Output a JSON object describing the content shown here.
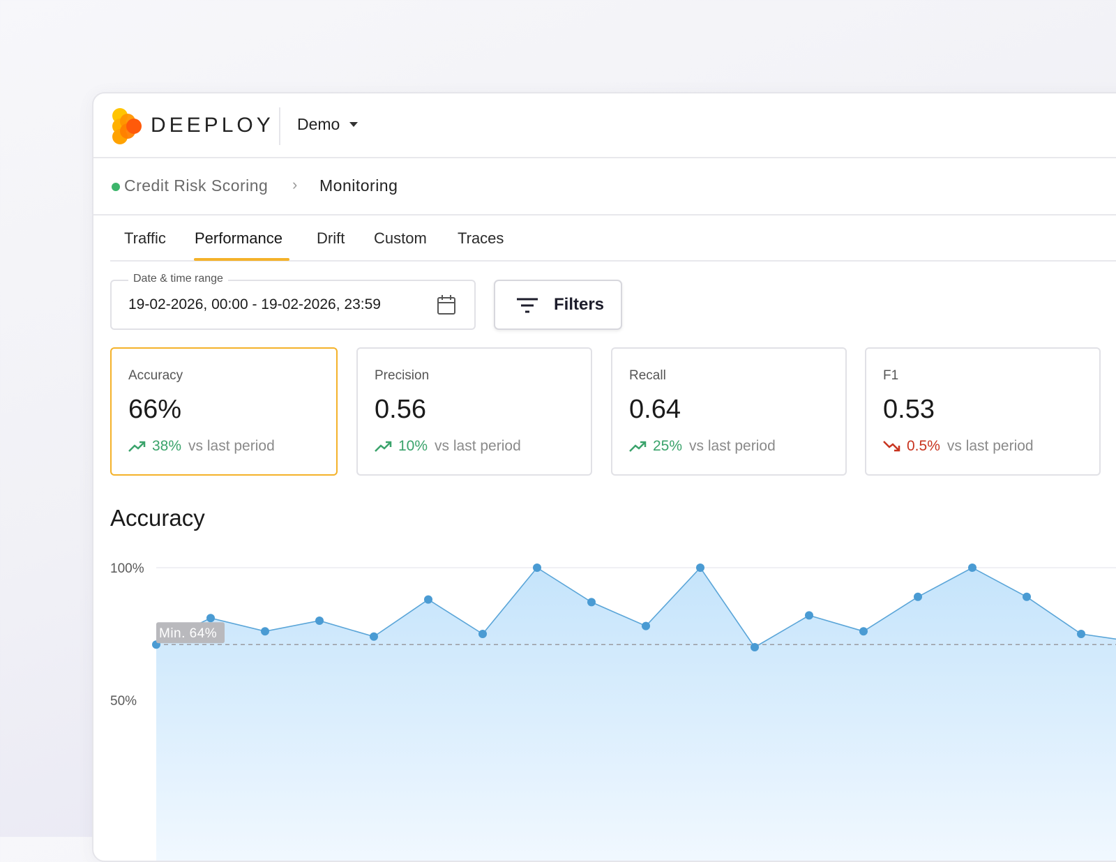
{
  "app": {
    "brand": "DEEPLOY",
    "workspace": "Demo"
  },
  "breadcrumb": {
    "project": "Credit Risk Scoring",
    "separator": "›",
    "page": "Monitoring",
    "status_color": "#3cb56b"
  },
  "tabs": [
    {
      "label": "Traffic",
      "active": false
    },
    {
      "label": "Performance",
      "active": true
    },
    {
      "label": "Drift",
      "active": false
    },
    {
      "label": "Custom",
      "active": false
    },
    {
      "label": "Traces",
      "active": false
    }
  ],
  "date_range": {
    "label": "Date & time range",
    "value": "19-02-2026, 00:00 - 19-02-2026, 23:59"
  },
  "filters": {
    "label": "Filters"
  },
  "metrics": [
    {
      "title": "Accuracy",
      "value": "66%",
      "change": "38%",
      "direction": "up",
      "suffix": "vs last period",
      "selected": true
    },
    {
      "title": "Precision",
      "value": "0.56",
      "change": "10%",
      "direction": "up",
      "suffix": "vs last period",
      "selected": false
    },
    {
      "title": "Recall",
      "value": "0.64",
      "change": "25%",
      "direction": "up",
      "suffix": "vs last period",
      "selected": false
    },
    {
      "title": "F1",
      "value": "0.53",
      "change": "0.5%",
      "direction": "down",
      "suffix": "vs last period",
      "selected": false
    }
  ],
  "colors": {
    "accent": "#f4b22a",
    "trend_up": "#3aa36b",
    "trend_down": "#c8341f",
    "line": "#5aa5d8",
    "point": "#4a9bd3"
  },
  "chart_data": {
    "type": "area",
    "title": "Accuracy",
    "yticks": [
      "100%",
      "50%"
    ],
    "ylim": [
      0,
      100
    ],
    "values": [
      71,
      81,
      76,
      80,
      74,
      88,
      75,
      100,
      87,
      78,
      100,
      70,
      82,
      76,
      89,
      100,
      89,
      75,
      72
    ],
    "min_line": {
      "value": 71,
      "label": "Min. 64%"
    },
    "grid": true
  }
}
